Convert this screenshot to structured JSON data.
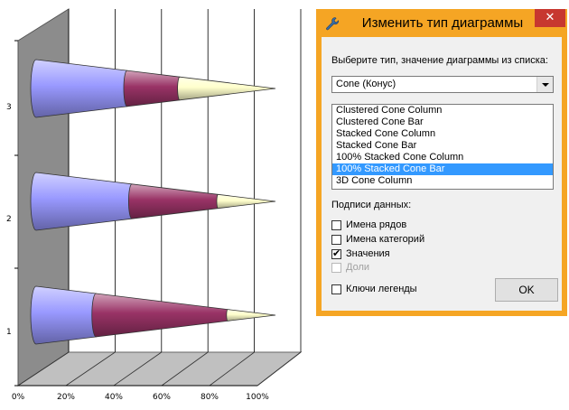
{
  "dialog": {
    "title": "Изменить тип диаграммы",
    "close_glyph": "✕",
    "prompt": "Выберите тип, значение диаграммы из списка:",
    "combo_value": "Cone (Конус)",
    "list_items": [
      "Clustered Cone Column",
      "Clustered Cone Bar",
      "Stacked Cone Column",
      "Stacked Cone Bar",
      "100% Stacked Cone Column",
      "100% Stacked Cone Bar",
      "3D Cone Column"
    ],
    "selected_index": 5,
    "data_labels_heading": "Подписи данных:",
    "options": [
      {
        "label": "Имена рядов",
        "checked": false,
        "enabled": true
      },
      {
        "label": "Имена категорий",
        "checked": false,
        "enabled": true
      },
      {
        "label": "Значения",
        "checked": true,
        "enabled": true
      },
      {
        "label": "Доли",
        "checked": false,
        "enabled": false
      }
    ],
    "legend_keys_label": "Ключи легенды",
    "legend_keys_checked": false,
    "ok_label": "OK",
    "icons": {
      "title": "wrench-icon",
      "close": "close-icon",
      "combo": "chevron-down-icon"
    }
  },
  "chart_data": {
    "type": "bar",
    "variant": "100% stacked 3D cone bar",
    "categories": [
      "1",
      "2",
      "3"
    ],
    "series": [
      {
        "values": [
          25,
          40,
          38
        ],
        "color": "#9999ff"
      },
      {
        "values": [
          55,
          36,
          22
        ],
        "color": "#993366"
      },
      {
        "values": [
          20,
          24,
          40
        ],
        "color": "#ffffcc"
      }
    ],
    "xlim": [
      0,
      100
    ],
    "x_ticks": [
      "0%",
      "20%",
      "40%",
      "60%",
      "80%",
      "100%"
    ],
    "grid": true,
    "legend": "none"
  }
}
